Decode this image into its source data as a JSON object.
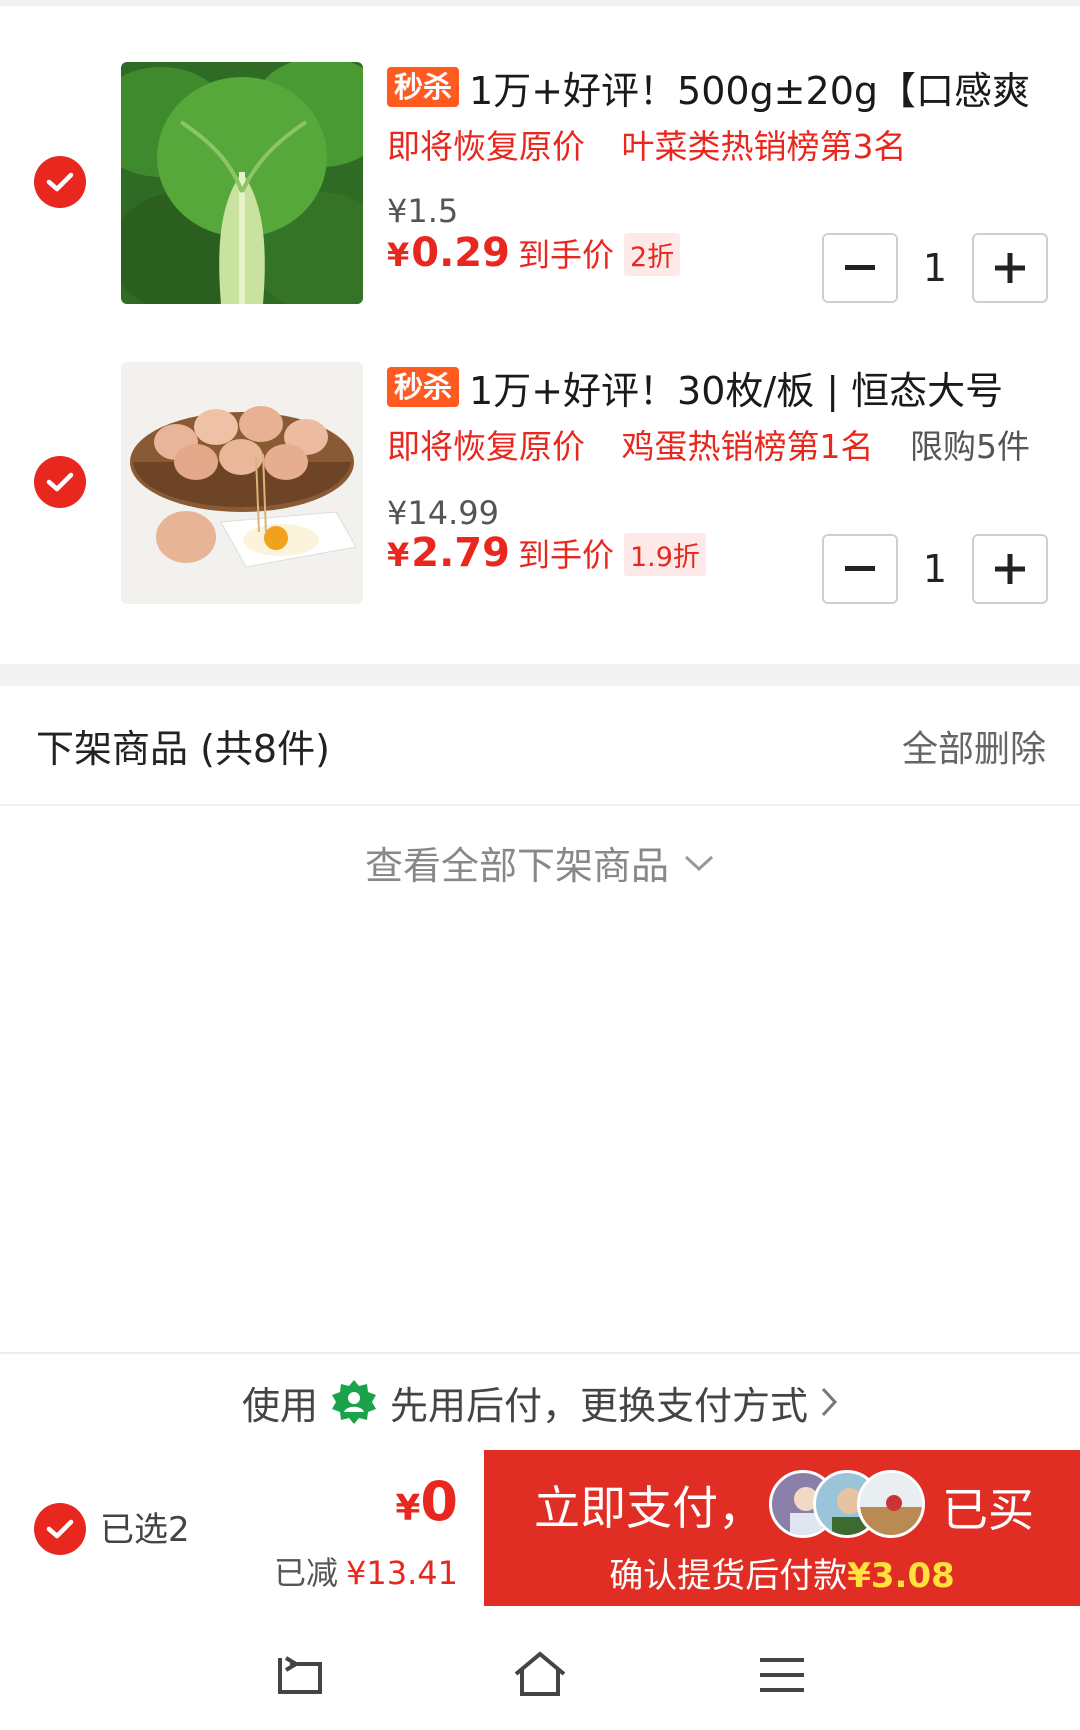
{
  "colors": {
    "accent": "#e8271e",
    "tag": "#ff5a1f",
    "pay_button": "#e02e24",
    "highlight_yellow": "#ffe23b"
  },
  "items": [
    {
      "tag": "秒杀",
      "title": "1万+好评！500g±20g【口感爽",
      "subs": [
        "即将恢复原价",
        "叶菜类热销榜第3名"
      ],
      "original_price": "¥1.5",
      "currency": "¥",
      "price": "0.29",
      "after_label": "到手价",
      "discount": "2折",
      "qty": "1",
      "image": "bok-choy-image"
    },
    {
      "tag": "秒杀",
      "title": "1万+好评！30枚/板 | 恒态大号",
      "subs": [
        "即将恢复原价",
        "鸡蛋热销榜第1名"
      ],
      "limit": "限购5件",
      "original_price": "¥14.99",
      "currency": "¥",
      "price": "2.79",
      "after_label": "到手价",
      "discount": "1.9折",
      "qty": "1",
      "image": "eggs-basket-image"
    }
  ],
  "offshelf": {
    "title": "下架商品 (共8件)",
    "delete_all": "全部删除",
    "view_all": "查看全部下架商品"
  },
  "payment": {
    "prefix": "使用",
    "method": "先用后付，更换支付方式"
  },
  "bottom": {
    "selected": "已选2",
    "currency": "¥",
    "total": "0",
    "saved_label": "已减",
    "saved_amount": "¥13.41",
    "pay_label": "立即支付，",
    "bought": "已买",
    "confirm": "确认提货后付款",
    "confirm_amount": "¥3.08"
  },
  "nav": [
    "back-icon",
    "home-icon",
    "menu-icon"
  ]
}
